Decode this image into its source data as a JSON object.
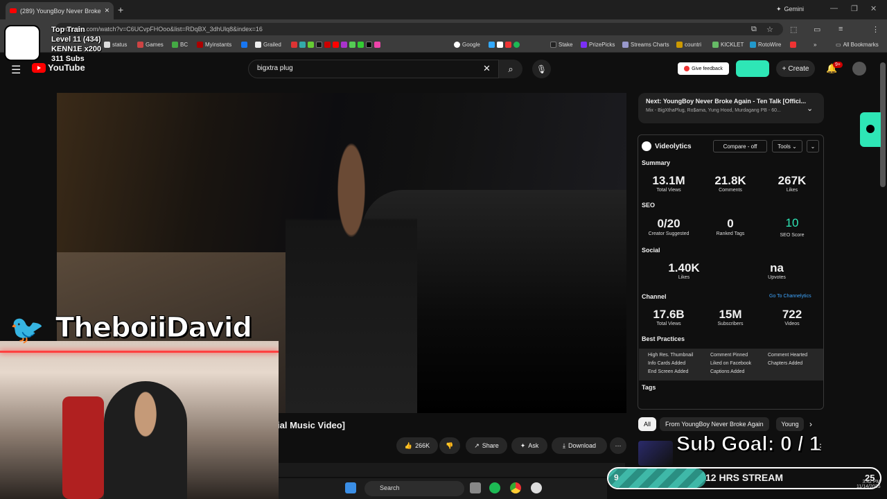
{
  "browser": {
    "tab_title": "(289) YoungBoy Never Broke",
    "new_tab": "+",
    "gemini": "Gemini",
    "url": "youtube.com/watch?v=C6UCvpFHOoo&list=RDqBX_3dhUlq8&index=16",
    "bookmarks": [
      "status",
      "Games",
      "BC",
      "Myinstants",
      "Grailed",
      "Google",
      "Stake",
      "PrizePicks",
      "Streams Charts",
      "countri",
      "KICKLET",
      "RotoWire"
    ],
    "all_bookmarks": "All Bookmarks"
  },
  "overlay": {
    "train_lines": [
      "Top Train",
      "Level 11  (434)",
      "KENN1E x200",
      "311 Subs"
    ],
    "twitter_name": "TheboiiDavid",
    "sub_goal": "Sub Goal: 0 / 1",
    "stream_left": "9",
    "stream_mid": "12 HRS STREAM",
    "stream_right": "25",
    "stream_progress": 0.36
  },
  "youtube": {
    "logo": "YouTube",
    "search_value": "bigxtra plug",
    "feedback": "Give feedback",
    "create": "Create",
    "bell_badge": "9+",
    "video_title": "ial Music Video]",
    "actions": {
      "likes": "266K",
      "share": "Share",
      "ask": "Ask",
      "download": "Download"
    },
    "next_label": "Next: YoungBoy Never Broke Again - Ten Talk [Offici...",
    "next_sub": "Mix - BigXthaPlug, Ro$ama, Yung Hood, Murdagang PB - 60...",
    "chips": [
      "All",
      "From YoungBoy Never Broke Again",
      "Young"
    ]
  },
  "videolytics": {
    "title": "Videolytics",
    "compare": "Compare - off",
    "tools": "Tools",
    "summary": "Summary",
    "summary_stats": [
      {
        "v": "13.1M",
        "l": "Total Views"
      },
      {
        "v": "21.8K",
        "l": "Comments"
      },
      {
        "v": "267K",
        "l": "Likes"
      }
    ],
    "seo": "SEO",
    "seo_stats": [
      {
        "v": "0/20",
        "l": "Creator Suggested"
      },
      {
        "v": "0",
        "l": "Ranked Tags"
      },
      {
        "v": "10",
        "l": "SEO Score"
      }
    ],
    "social": "Social",
    "social_stats": [
      {
        "v": "1.40K",
        "l": "Likes"
      },
      {
        "v": "na",
        "l": "Upvotes"
      }
    ],
    "channel": "Channel",
    "goto": "Go To Channelytics",
    "channel_stats": [
      {
        "v": "17.6B",
        "l": "Total Views"
      },
      {
        "v": "15M",
        "l": "Subscribers"
      },
      {
        "v": "722",
        "l": "Videos"
      }
    ],
    "best_practices": "Best Practices",
    "bp_items": [
      "High Res. Thumbnail",
      "Comment Pinned",
      "Comment Hearted",
      "Info Cards Added",
      "Liked on Facebook",
      "Chapters Added",
      "End Screen Added",
      "Captions Added"
    ],
    "tags": "Tags",
    "accent": "#2ee6b6"
  },
  "taskbar": {
    "search": "Search",
    "time": "3:42 PM",
    "date": "11/14/2025"
  }
}
